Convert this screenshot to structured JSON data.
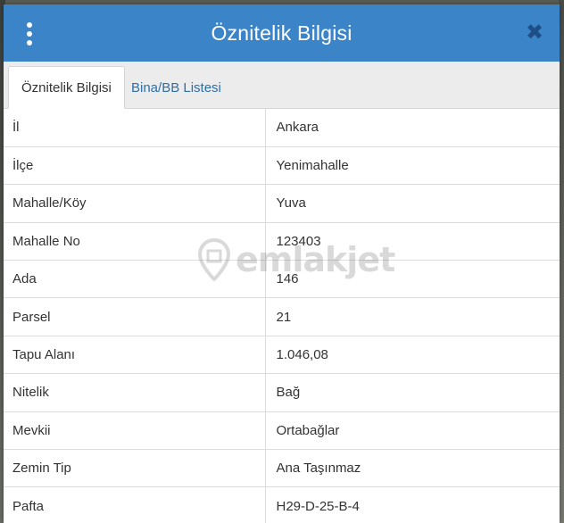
{
  "dialog": {
    "title": "Öznitelik Bilgisi",
    "close_symbol": "✖",
    "menu_icon": "vertical-dots-icon"
  },
  "tabs": [
    {
      "label": "Öznitelik Bilgisi",
      "active": true
    },
    {
      "label": "Bina/BB Listesi",
      "active": false
    }
  ],
  "rows": [
    {
      "key": "İl",
      "value": "Ankara"
    },
    {
      "key": "İlçe",
      "value": "Yenimahalle"
    },
    {
      "key": "Mahalle/Köy",
      "value": "Yuva"
    },
    {
      "key": "Mahalle No",
      "value": "123403"
    },
    {
      "key": "Ada",
      "value": "146"
    },
    {
      "key": "Parsel",
      "value": "21"
    },
    {
      "key": "Tapu Alanı",
      "value": "1.046,08"
    },
    {
      "key": "Nitelik",
      "value": "Bağ"
    },
    {
      "key": "Mevkii",
      "value": "Ortabağlar"
    },
    {
      "key": "Zemin Tip",
      "value": "Ana Taşınmaz"
    },
    {
      "key": "Pafta",
      "value": "H29-D-25-B-4"
    }
  ],
  "watermark": {
    "text": "emlakjet",
    "icon": "location-pin-icon"
  },
  "colors": {
    "header": "#3b84c8",
    "close": "#1d4f86",
    "tab_link": "#2f6fa8"
  }
}
